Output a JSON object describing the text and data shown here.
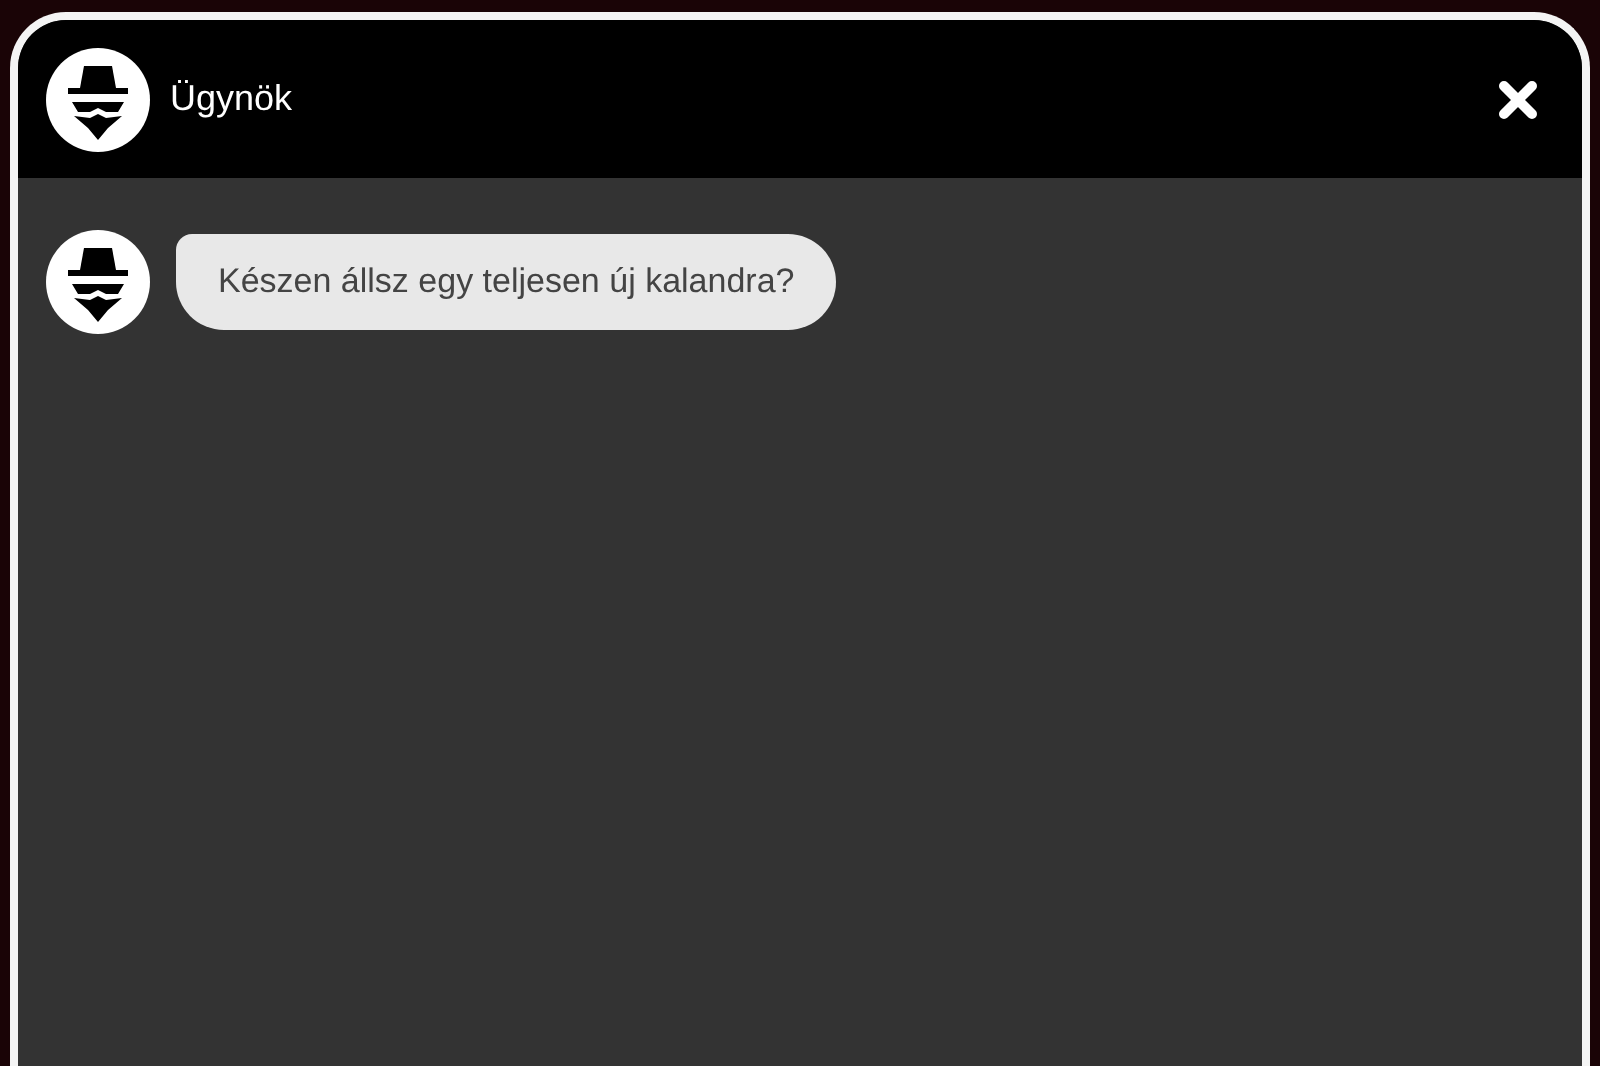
{
  "header": {
    "title": "Ügynök"
  },
  "messages": [
    {
      "kind": "incoming",
      "text": "Készen állsz egy teljesen új kalandra?"
    }
  ]
}
